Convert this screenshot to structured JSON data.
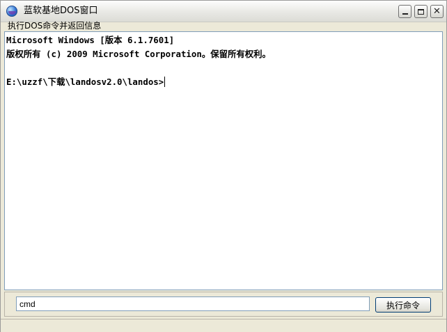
{
  "window": {
    "title": "蓝软基地DOS窗口",
    "icon": "globe-icon",
    "controls": {
      "minimize_icon": "minimize-icon",
      "maximize_icon": "maximize-icon",
      "close_icon": "close-icon",
      "close_glyph": "✕"
    }
  },
  "output_label": "执行DOS命令并返回信息",
  "console": {
    "lines": [
      "Microsoft Windows [版本 6.1.7601]",
      "版权所有 (c) 2009 Microsoft Corporation。保留所有权利。",
      "",
      "E:\\uzzf\\下载\\landosv2.0\\landos>"
    ]
  },
  "command": {
    "value": "cmd",
    "button_label": "执行命令"
  }
}
